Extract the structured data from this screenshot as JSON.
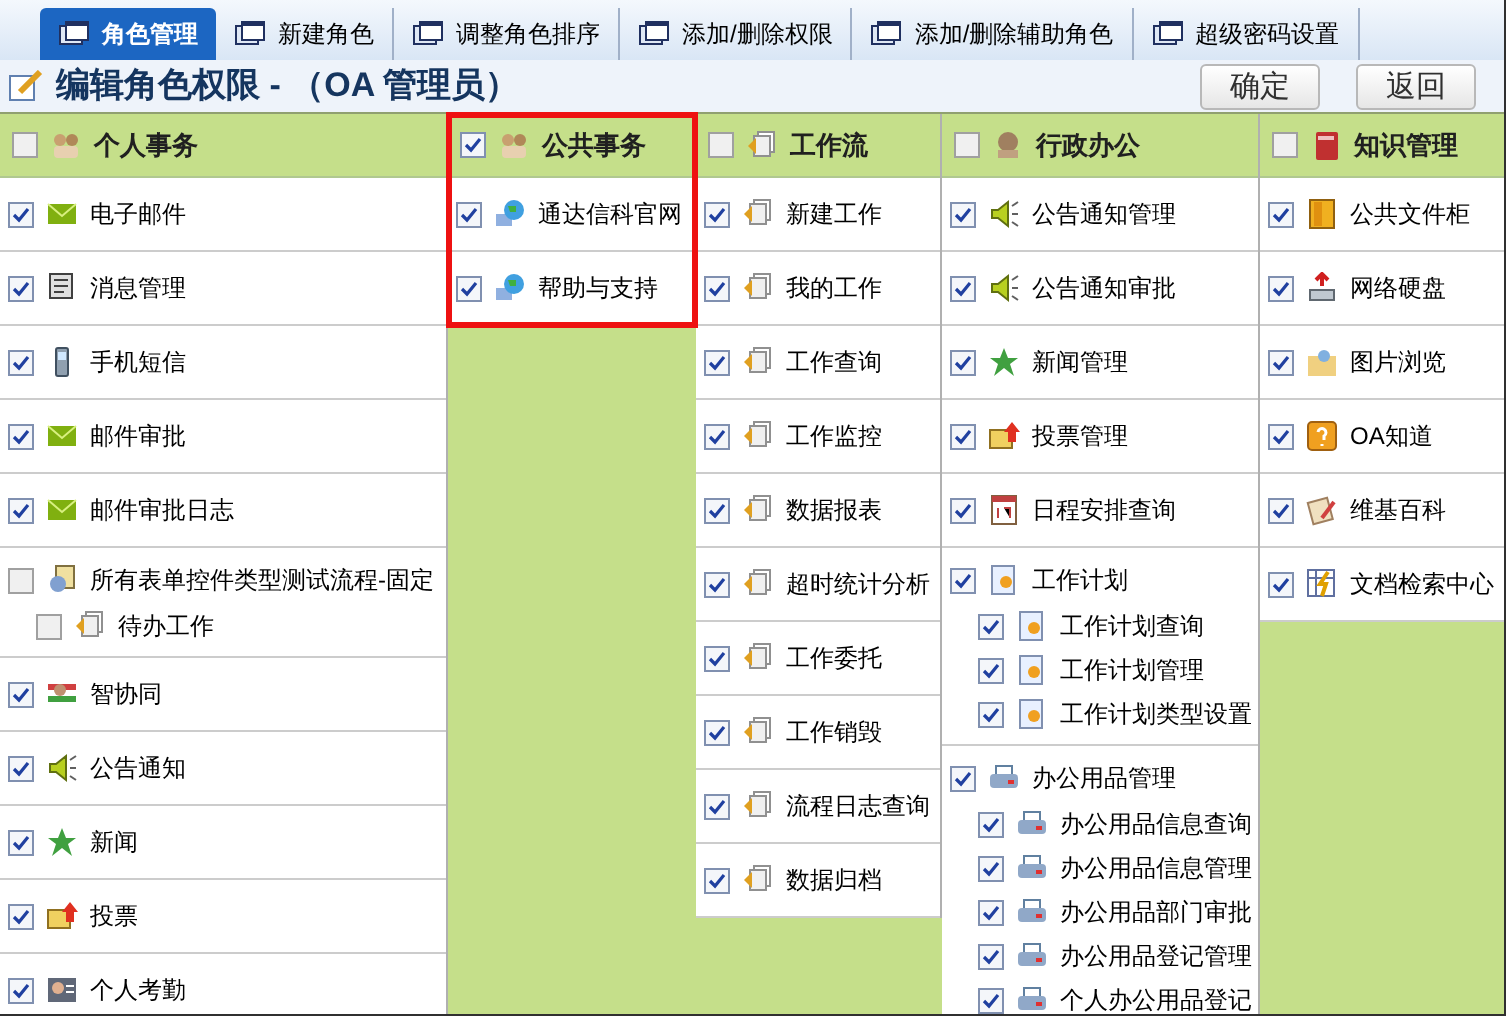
{
  "tabs": [
    {
      "label": "角色管理",
      "selected": true
    },
    {
      "label": "新建角色",
      "selected": false
    },
    {
      "label": "调整角色排序",
      "selected": false
    },
    {
      "label": "添加/删除权限",
      "selected": false
    },
    {
      "label": "添加/删除辅助角色",
      "selected": false
    },
    {
      "label": "超级密码设置",
      "selected": false
    }
  ],
  "title": "编辑角色权限 - （OA 管理员）",
  "buttons": [
    "确定",
    "返回"
  ],
  "sections": [
    {
      "title": "个人事务",
      "kind": "people",
      "checked": false,
      "highlighted": false,
      "items": [
        {
          "label": "电子邮件",
          "kind": "mail",
          "checked": true
        },
        {
          "label": "消息管理",
          "kind": "message",
          "checked": true
        },
        {
          "label": "手机短信",
          "kind": "phone",
          "checked": true
        },
        {
          "label": "邮件审批",
          "kind": "mail",
          "checked": true
        },
        {
          "label": "邮件审批日志",
          "kind": "mail",
          "checked": true
        },
        {
          "label": "所有表单控件类型测试流程-固定",
          "kind": "form",
          "checked": false,
          "children": [
            {
              "label": "待办工作",
              "kind": "workflow",
              "checked": false
            }
          ]
        },
        {
          "label": "智协同",
          "kind": "contract",
          "checked": true
        },
        {
          "label": "公告通知",
          "kind": "speaker",
          "checked": true
        },
        {
          "label": "新闻",
          "kind": "star",
          "checked": true
        },
        {
          "label": "投票",
          "kind": "vote",
          "checked": true
        },
        {
          "label": "个人考勤",
          "kind": "attendance",
          "checked": true
        }
      ]
    },
    {
      "title": "公共事务",
      "kind": "people",
      "checked": true,
      "highlighted": true,
      "items": [
        {
          "label": "通达信科官网",
          "kind": "globe",
          "checked": true
        },
        {
          "label": "帮助与支持",
          "kind": "globe",
          "checked": true
        }
      ]
    },
    {
      "title": "工作流",
      "kind": "workflow",
      "checked": false,
      "highlighted": false,
      "items": [
        {
          "label": "新建工作",
          "kind": "workflow",
          "checked": true
        },
        {
          "label": "我的工作",
          "kind": "workflow",
          "checked": true
        },
        {
          "label": "工作查询",
          "kind": "workflow",
          "checked": true
        },
        {
          "label": "工作监控",
          "kind": "workflow",
          "checked": true
        },
        {
          "label": "数据报表",
          "kind": "workflow",
          "checked": true
        },
        {
          "label": "超时统计分析",
          "kind": "workflow",
          "checked": true
        },
        {
          "label": "工作委托",
          "kind": "workflow",
          "checked": true
        },
        {
          "label": "工作销毁",
          "kind": "workflow",
          "checked": true
        },
        {
          "label": "流程日志查询",
          "kind": "workflow",
          "checked": true
        },
        {
          "label": "数据归档",
          "kind": "workflow",
          "checked": true
        }
      ]
    },
    {
      "title": "行政办公",
      "kind": "admin",
      "checked": false,
      "highlighted": false,
      "items": [
        {
          "label": "公告通知管理",
          "kind": "speaker",
          "checked": true
        },
        {
          "label": "公告通知审批",
          "kind": "speaker",
          "checked": true
        },
        {
          "label": "新闻管理",
          "kind": "star",
          "checked": true
        },
        {
          "label": "投票管理",
          "kind": "vote",
          "checked": true
        },
        {
          "label": "日程安排查询",
          "kind": "calendar",
          "checked": true
        },
        {
          "label": "工作计划",
          "kind": "plan",
          "checked": true,
          "children": [
            {
              "label": "工作计划查询",
              "kind": "plan",
              "checked": true
            },
            {
              "label": "工作计划管理",
              "kind": "plan",
              "checked": true
            },
            {
              "label": "工作计划类型设置",
              "kind": "plan",
              "checked": true
            }
          ]
        },
        {
          "label": "办公用品管理",
          "kind": "printer",
          "checked": true,
          "children": [
            {
              "label": "办公用品信息查询",
              "kind": "printer",
              "checked": true
            },
            {
              "label": "办公用品信息管理",
              "kind": "printer",
              "checked": true
            },
            {
              "label": "办公用品部门审批",
              "kind": "printer",
              "checked": true
            },
            {
              "label": "办公用品登记管理",
              "kind": "printer",
              "checked": true
            },
            {
              "label": "个人办公用品登记",
              "kind": "printer",
              "checked": true
            }
          ]
        }
      ]
    },
    {
      "title": "知识管理",
      "kind": "book",
      "checked": false,
      "highlighted": false,
      "items": [
        {
          "label": "公共文件柜",
          "kind": "folder",
          "checked": true
        },
        {
          "label": "网络硬盘",
          "kind": "disk",
          "checked": true
        },
        {
          "label": "图片浏览",
          "kind": "picture",
          "checked": true
        },
        {
          "label": "OA知道",
          "kind": "question",
          "checked": true
        },
        {
          "label": "维基百科",
          "kind": "wiki",
          "checked": true
        },
        {
          "label": "文档检索中心",
          "kind": "docsearch",
          "checked": true
        }
      ]
    }
  ]
}
